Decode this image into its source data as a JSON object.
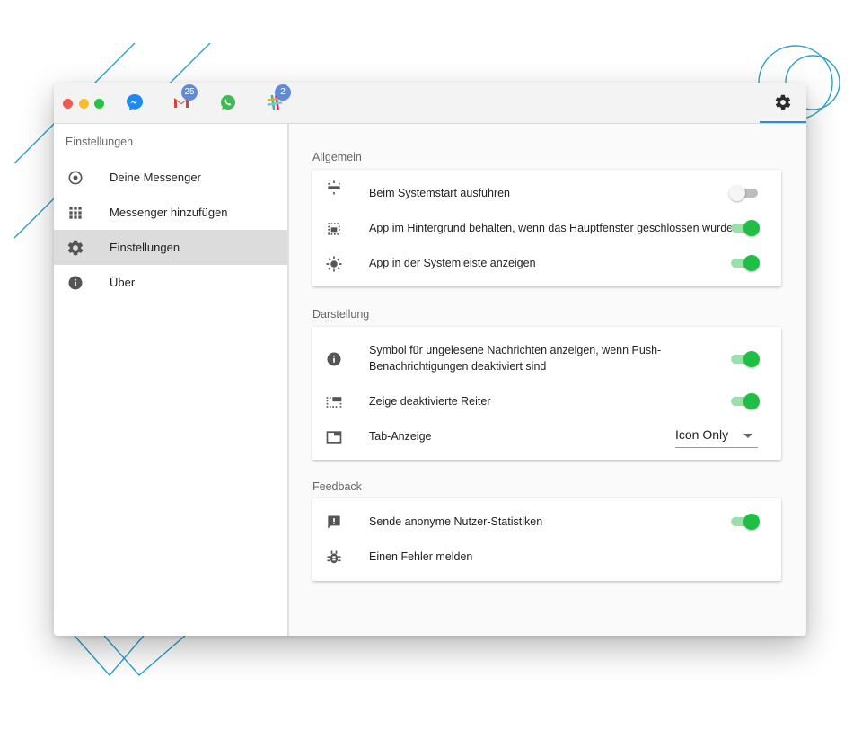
{
  "titlebar": {
    "services": [
      {
        "icon": "messenger-icon",
        "badge": ""
      },
      {
        "icon": "gmail-icon",
        "badge": "25"
      },
      {
        "icon": "whatsapp-icon",
        "badge": ""
      },
      {
        "icon": "slack-icon",
        "badge": "2"
      }
    ],
    "settings_icon": "gear-icon"
  },
  "sidebar": {
    "title": "Einstellungen",
    "items": [
      {
        "label": "Deine Messenger",
        "icon": "radio-circle-icon"
      },
      {
        "label": "Messenger hinzufügen",
        "icon": "apps-grid-icon"
      },
      {
        "label": "Einstellungen",
        "icon": "gear-icon",
        "active": true
      },
      {
        "label": "Über",
        "icon": "info-icon"
      }
    ]
  },
  "sections": {
    "general": {
      "title": "Allgemein",
      "rows": [
        {
          "label": "Beim Systemstart ausführen",
          "icon": "power-settings-icon",
          "enabled": false
        },
        {
          "label": "App im Hintergrund behalten, wenn das Hauptfenster geschlossen wurde",
          "icon": "picture-in-picture-icon",
          "enabled": true
        },
        {
          "label": "App in der Systemleiste anzeigen",
          "icon": "brightness-icon",
          "enabled": true
        }
      ]
    },
    "appearance": {
      "title": "Darstellung",
      "rows": [
        {
          "label": "Symbol für ungelesene Nachrichten anzeigen, wenn Push-Benachrichtigungen deaktiviert sind",
          "icon": "info-icon",
          "enabled": true
        },
        {
          "label": "Zeige deaktivierte Reiter",
          "icon": "tab-unselected-icon",
          "enabled": true
        },
        {
          "label": "Tab-Anzeige",
          "icon": "tab-icon",
          "select_value": "Icon Only"
        }
      ]
    },
    "feedback": {
      "title": "Feedback",
      "rows": [
        {
          "label": "Sende anonyme Nutzer-Statistiken",
          "icon": "feedback-icon",
          "enabled": true
        },
        {
          "label": "Einen Fehler melden",
          "icon": "bug-icon"
        }
      ]
    }
  },
  "colors": {
    "accent_blue": "#2a8bd6",
    "toggle_on": "#1fbe44",
    "toggle_on_track": "#9be0a8",
    "badge": "#5e8ad6",
    "decor_line": "#2aa3c8"
  }
}
